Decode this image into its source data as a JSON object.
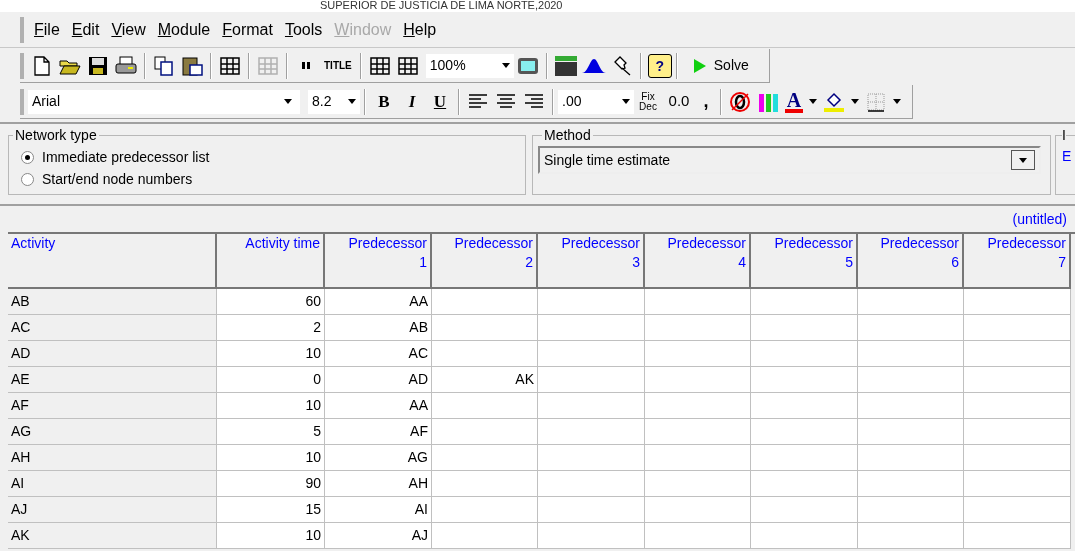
{
  "banner": "SUPERIOR DE JUSTICIA DE LIMA NORTE,2020",
  "menu": [
    {
      "label": "File",
      "disabled": false
    },
    {
      "label": "Edit",
      "disabled": false
    },
    {
      "label": "View",
      "disabled": false
    },
    {
      "label": "Module",
      "disabled": false
    },
    {
      "label": "Format",
      "disabled": false
    },
    {
      "label": "Tools",
      "disabled": false
    },
    {
      "label": "Window",
      "disabled": true
    },
    {
      "label": "Help",
      "disabled": false
    }
  ],
  "toolbar": {
    "title_button": "TITLE",
    "zoom": "100%",
    "help": "?",
    "solve": "Solve"
  },
  "format_bar": {
    "font": "Arial",
    "size": "8.2",
    "bold": "B",
    "italic": "I",
    "underline": "U",
    "decimals": ".00",
    "fix": "Fix",
    "dec": "Dec",
    "zero": "0.0",
    "comma": ",",
    "font_color": "A"
  },
  "network_type": {
    "title": "Network type",
    "options": [
      {
        "label": "Immediate predecessor list",
        "selected": true
      },
      {
        "label": "Start/end node numbers",
        "selected": false
      }
    ]
  },
  "method": {
    "title": "Method",
    "value": "Single time estimate"
  },
  "cut_group": {
    "title": "I",
    "value": "E"
  },
  "file_name": "(untitled)",
  "columns": [
    {
      "label": "Activity"
    },
    {
      "label": "Activity time"
    },
    {
      "label": "Predecessor",
      "number": "1"
    },
    {
      "label": "Predecessor",
      "number": "2"
    },
    {
      "label": "Predecessor",
      "number": "3"
    },
    {
      "label": "Predecessor",
      "number": "4"
    },
    {
      "label": "Predecessor",
      "number": "5"
    },
    {
      "label": "Predecessor",
      "number": "6"
    },
    {
      "label": "Predecessor",
      "number": "7"
    }
  ],
  "rows": [
    {
      "activity": "AB",
      "time": "60",
      "predecessors": [
        "AA"
      ]
    },
    {
      "activity": "AC",
      "time": "2",
      "predecessors": [
        "AB"
      ]
    },
    {
      "activity": "AD",
      "time": "10",
      "predecessors": [
        "AC"
      ]
    },
    {
      "activity": "AE",
      "time": "0",
      "predecessors": [
        "AD",
        "AK"
      ]
    },
    {
      "activity": "AF",
      "time": "10",
      "predecessors": [
        "AA"
      ]
    },
    {
      "activity": "AG",
      "time": "5",
      "predecessors": [
        "AF"
      ]
    },
    {
      "activity": "AH",
      "time": "10",
      "predecessors": [
        "AG"
      ]
    },
    {
      "activity": "AI",
      "time": "90",
      "predecessors": [
        "AH"
      ]
    },
    {
      "activity": "AJ",
      "time": "15",
      "predecessors": [
        "AI"
      ]
    },
    {
      "activity": "AK",
      "time": "10",
      "predecessors": [
        "AJ"
      ]
    }
  ]
}
